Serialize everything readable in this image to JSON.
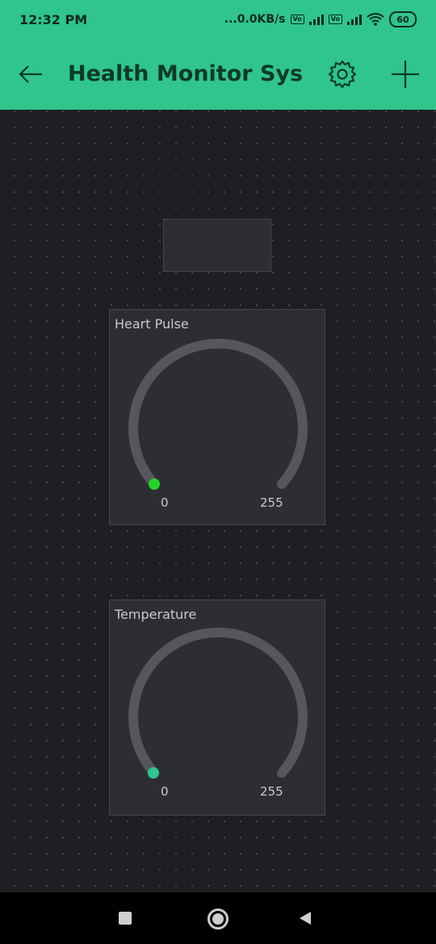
{
  "status": {
    "time": "12:32 PM",
    "net_speed": "...0.0KB/s",
    "battery": "60"
  },
  "header": {
    "title": "Health Monitor Syst...",
    "icons": [
      "arrow-left-icon",
      "gear-icon",
      "plus-icon"
    ]
  },
  "widgets": {
    "gauges": [
      {
        "label": "Heart Pulse",
        "min": "0",
        "max": "255",
        "value": 0,
        "dot_color": "#23d623"
      },
      {
        "label": "Temperature",
        "min": "0",
        "max": "255",
        "value": 0,
        "dot_color": "#2fc58c"
      }
    ]
  },
  "colors": {
    "accent": "#2fc58c",
    "background": "#1e1f23",
    "widget": "#2d2e33",
    "gauge_track": "#55575c"
  },
  "navbar": {
    "icons": [
      "square-icon",
      "circle-icon",
      "triangle-back-icon"
    ]
  }
}
